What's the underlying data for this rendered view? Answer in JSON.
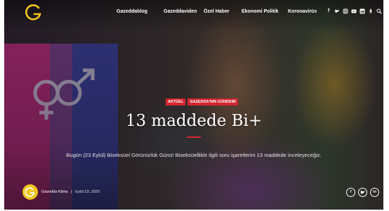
{
  "brand": {
    "logo_letter": "G",
    "logo_color": "#f2c51c"
  },
  "nav": {
    "items": [
      "Gazeddablog",
      "Gazeddavideo",
      "Özel Haber",
      "Ekonomi Politik",
      "Koronavirüs"
    ]
  },
  "social_icons": [
    "facebook-icon",
    "twitter-icon",
    "instagram-icon",
    "youtube-icon",
    "linkedin-icon",
    "podcast-icon",
    "search-icon"
  ],
  "article": {
    "tags": [
      "AKTÜEL",
      "GAZEDDA'NIN GÜNDEMİ"
    ],
    "title": "13 maddede Bi+",
    "description": "Bugün (23 Eylül) Biseksüel Görünürlük Günü! Biseksüellikle ilgili soru işaretlerini 13 maddede inceleyeceğiz.",
    "author": "Gazedda Kitina",
    "separator": "|",
    "date": "Eylül 23, 2020"
  },
  "share": [
    "facebook-icon",
    "twitter-icon",
    "linkedin-icon"
  ],
  "colors": {
    "accent": "#d3262f",
    "logo": "#f2c51c"
  }
}
